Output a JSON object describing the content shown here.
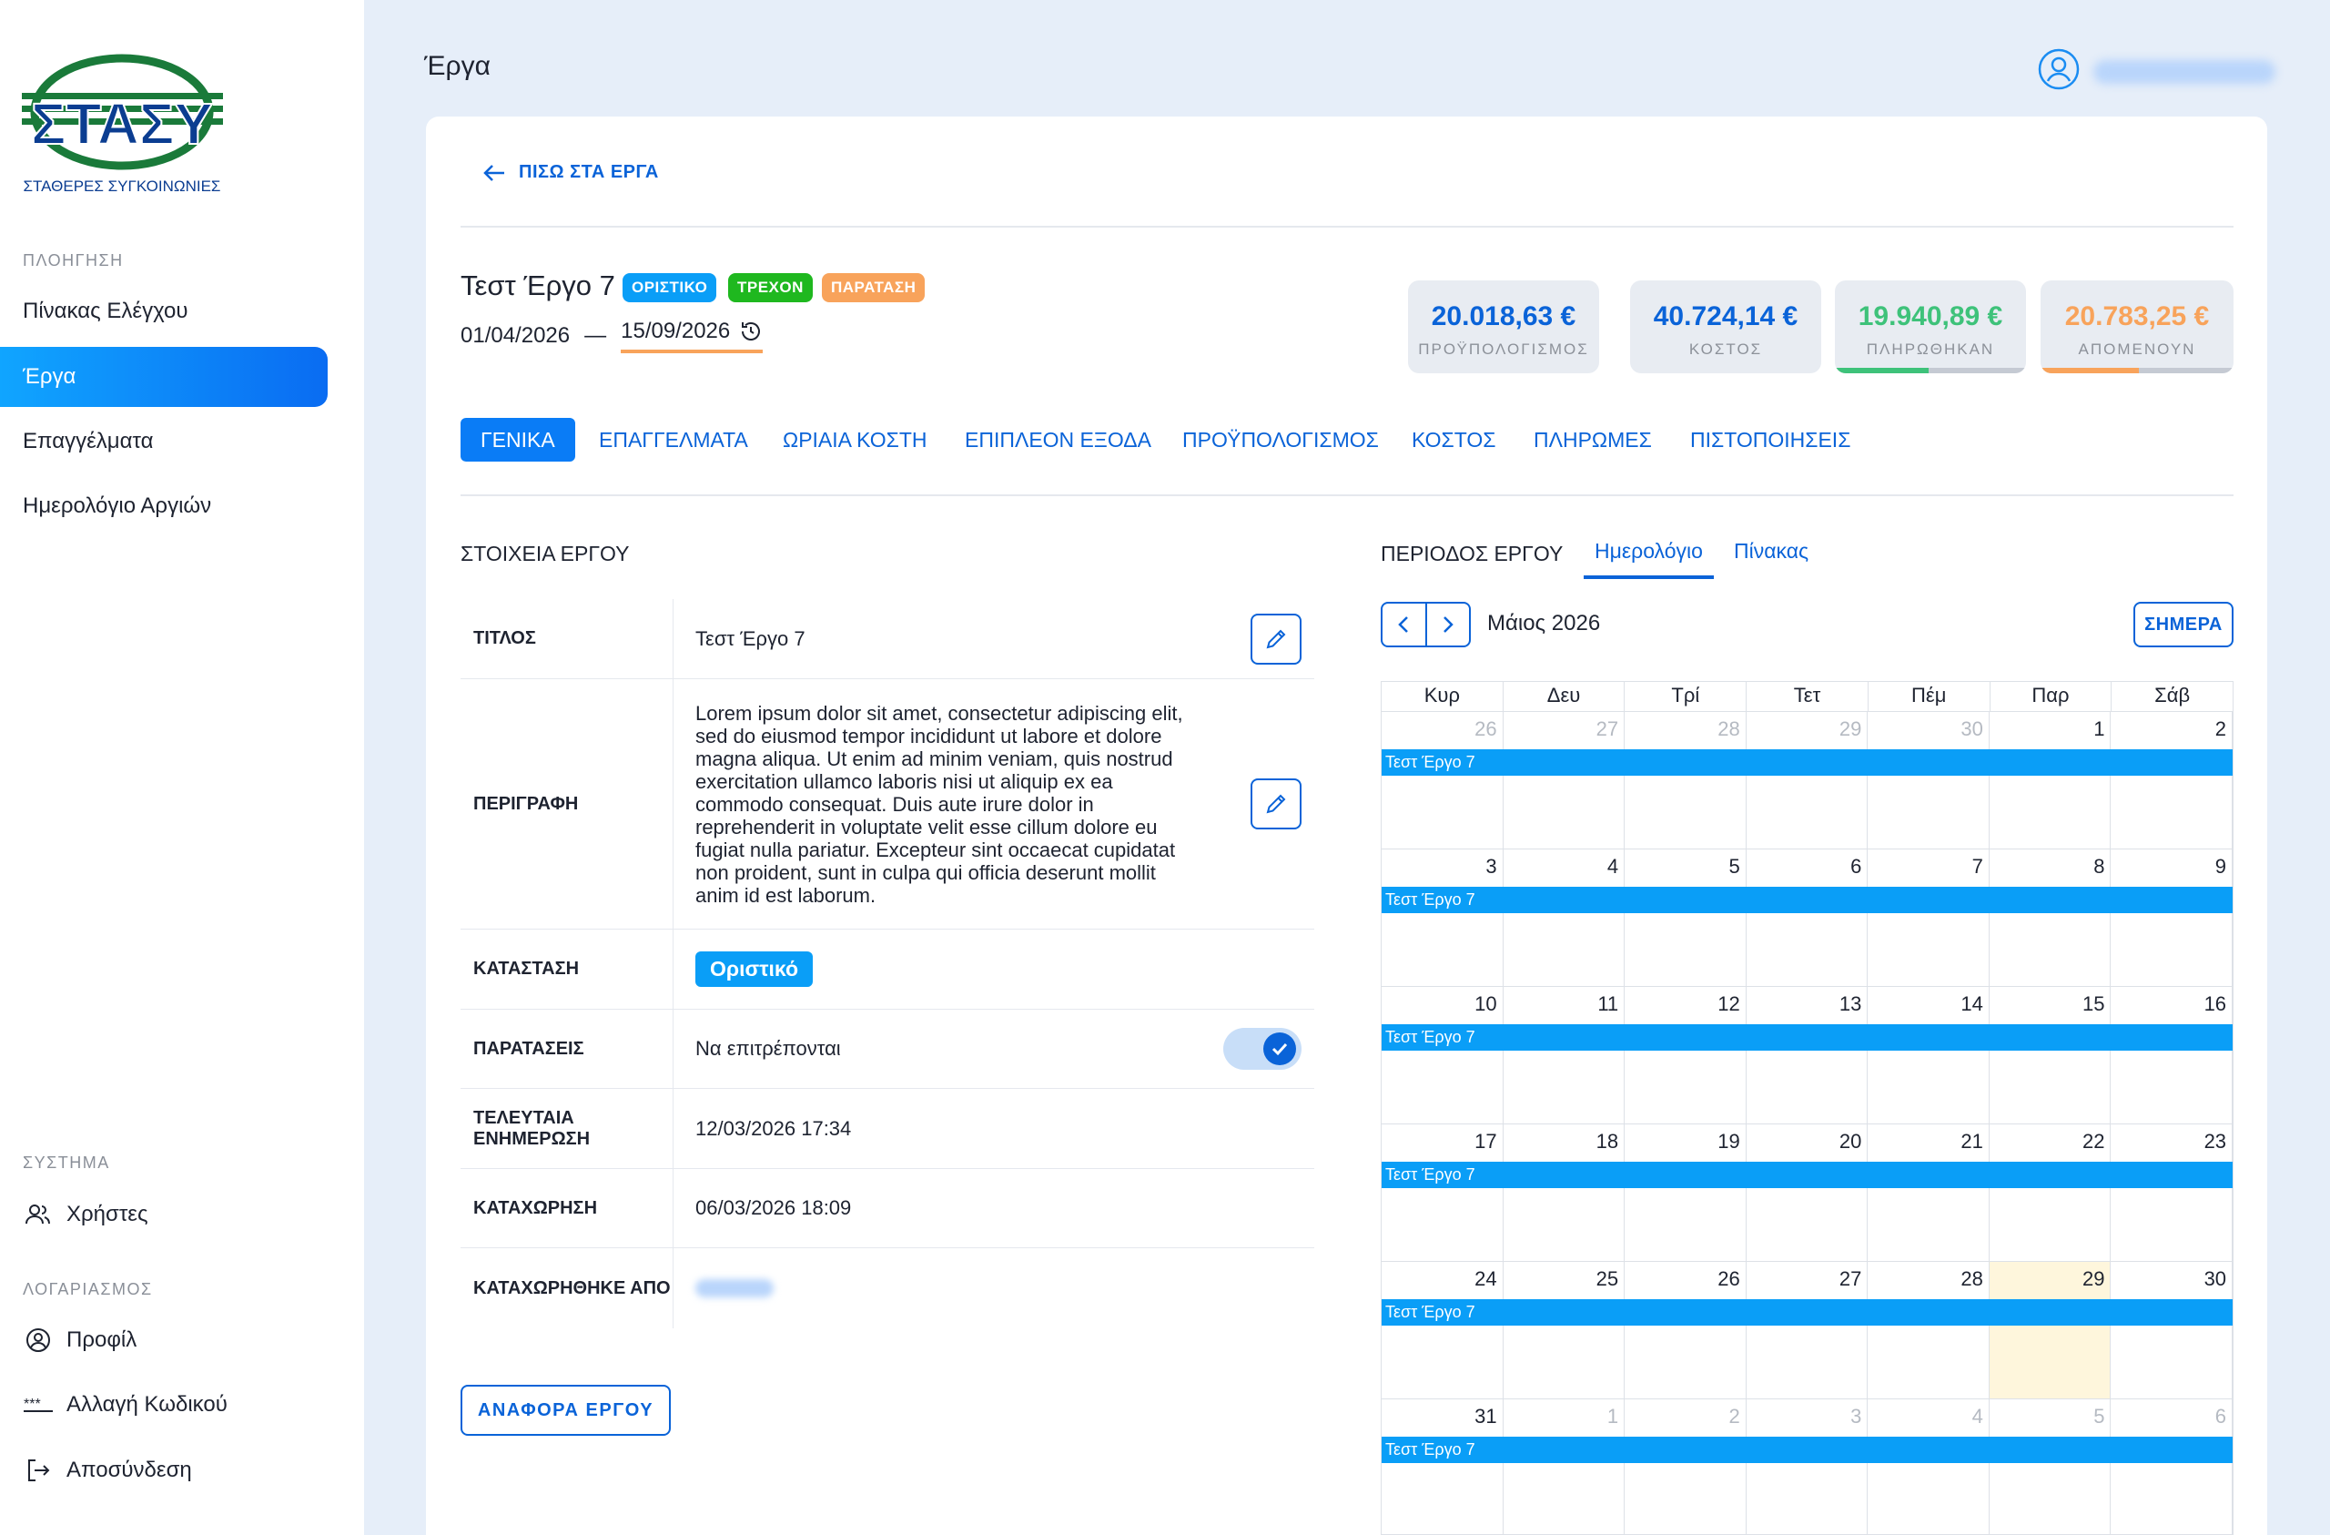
{
  "sidebar": {
    "logo_text": "ΣΤΑΣΥ",
    "logo_subtitle": "ΣΤΑΘΕΡΕΣ ΣΥΓΚΟΙΝΩΝΙΕΣ",
    "nav_section": "ΠΛΟΗΓΗΣΗ",
    "nav_items": [
      {
        "label": "Πίνακας Ελέγχου",
        "active": false
      },
      {
        "label": "Έργα",
        "active": true
      },
      {
        "label": "Επαγγέλματα",
        "active": false
      },
      {
        "label": "Ημερολόγιο Αργιών",
        "active": false
      }
    ],
    "system_section": "ΣΥΣΤΗΜΑ",
    "system_items": [
      {
        "label": "Χρήστες",
        "icon": "users-icon"
      }
    ],
    "account_section": "ΛΟΓΑΡΙΑΣΜΟΣ",
    "account_items": [
      {
        "label": "Προφίλ",
        "icon": "profile-icon"
      },
      {
        "label": "Αλλαγή Κωδικού",
        "icon": "password-icon"
      },
      {
        "label": "Αποσύνδεση",
        "icon": "logout-icon"
      }
    ]
  },
  "header": {
    "title": "Έργα",
    "user_icon": "user-icon"
  },
  "project": {
    "back_label": "ΠΙΣΩ ΣΤΑ ΕΡΓΑ",
    "title": "Τεστ Έργο 7",
    "badges": [
      {
        "label": "ΟΡΙΣΤΙΚΟ",
        "color": "#0a9ef7"
      },
      {
        "label": "ΤΡΕΧΟΝ",
        "color": "#1fb81f"
      },
      {
        "label": "ΠΑΡΑΤΑΣΗ",
        "color": "#f8a35b"
      }
    ],
    "date_start": "01/04/2026",
    "date_sep": "—",
    "date_end": "15/09/2026"
  },
  "stats": [
    {
      "value": "20.018,63 €",
      "label": "ΠΡΟΫΠΟΛΟΓΙΣΜΟΣ",
      "color": "#0a63d8",
      "progress": null
    },
    {
      "value": "40.724,14 €",
      "label": "ΚΟΣΤΟΣ",
      "color": "#0a63d8",
      "progress": null
    },
    {
      "value": "19.940,89 €",
      "label": "ΠΛΗΡΩΘΗΚΑΝ",
      "color": "#3ec27a",
      "progress": 0.49
    },
    {
      "value": "20.783,25 €",
      "label": "ΑΠΟΜΕΝΟΥΝ",
      "color": "#f8a35b",
      "progress": 0.51
    }
  ],
  "tabs": [
    "ΓΕΝΙΚΑ",
    "ΕΠΑΓΓΕΛΜΑΤΑ",
    "ΩΡΙΑΙΑ ΚΟΣΤΗ",
    "ΕΠΙΠΛΕΟΝ ΕΞΟΔΑ",
    "ΠΡΟΫΠΟΛΟΓΙΣΜΟΣ",
    "ΚΟΣΤΟΣ",
    "ΠΛΗΡΩΜΕΣ",
    "ΠΙΣΤΟΠΟΙΗΣΕΙΣ"
  ],
  "active_tab": "ΓΕΝΙΚΑ",
  "details": {
    "heading": "ΣΤΟΙΧΕΙΑ ΕΡΓΟΥ",
    "title_label": "ΤΙΤΛΟΣ",
    "title_value": "Τεστ Έργο 7",
    "desc_label": "ΠΕΡΙΓΡΑΦΗ",
    "desc_value": "Lorem ipsum dolor sit amet, consectetur adipiscing elit, sed do eiusmod tempor incididunt ut labore et dolore magna aliqua. Ut enim ad minim veniam, quis nostrud exercitation ullamco laboris nisi ut aliquip ex ea commodo consequat. Duis aute irure dolor in reprehenderit in voluptate velit esse cillum dolore eu fugiat nulla pariatur. Excepteur sint occaecat cupidatat non proident, sunt in culpa qui officia deserunt mollit anim id est laborum.",
    "status_label": "ΚΑΤΑΣΤΑΣΗ",
    "status_value": "Οριστικό",
    "ext_label": "ΠΑΡΑΤΑΣΕΙΣ",
    "ext_value": "Να επιτρέπονται",
    "ext_enabled": true,
    "updated_label": "ΤΕΛΕΥΤΑΙΑ ΕΝΗΜΕΡΩΣΗ",
    "updated_value": "12/03/2026 17:34",
    "created_label": "ΚΑΤΑΧΩΡΗΣΗ",
    "created_value": "06/03/2026 18:09",
    "created_by_label": "ΚΑΤΑΧΩΡΗΘΗΚΕ ΑΠΟ",
    "report_button": "ΑΝΑΦΟΡΑ ΕΡΓΟΥ"
  },
  "calendar": {
    "heading": "ΠΕΡΙΟΔΟΣ ΕΡΓΟΥ",
    "view_tabs": [
      "Ημερολόγιο",
      "Πίνακας"
    ],
    "month_title": "Μάιος 2026",
    "today_button": "ΣΗΜΕΡΑ",
    "weekdays": [
      "Κυρ",
      "Δευ",
      "Τρί",
      "Τετ",
      "Πέμ",
      "Παρ",
      "Σάβ"
    ],
    "event_label": "Τεστ Έργο 7",
    "weeks": [
      [
        26,
        27,
        28,
        29,
        30,
        1,
        2
      ],
      [
        3,
        4,
        5,
        6,
        7,
        8,
        9
      ],
      [
        10,
        11,
        12,
        13,
        14,
        15,
        16
      ],
      [
        17,
        18,
        19,
        20,
        21,
        22,
        23
      ],
      [
        24,
        25,
        26,
        27,
        28,
        29,
        30
      ],
      [
        31,
        1,
        2,
        3,
        4,
        5,
        6
      ]
    ],
    "today": 29
  }
}
